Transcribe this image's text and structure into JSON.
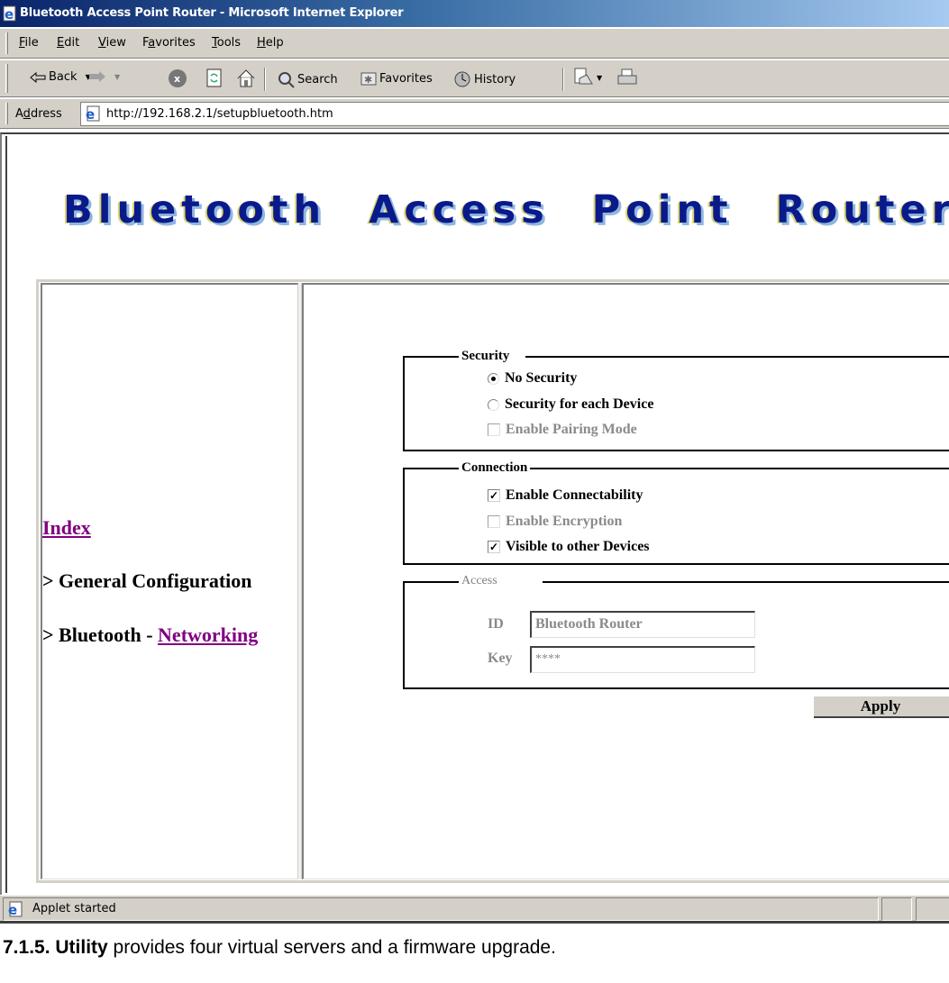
{
  "window": {
    "title": "Bluetooth Access Point Router - Microsoft Internet Explorer"
  },
  "menu": [
    {
      "label": "File",
      "access": "F",
      "rest": "ile"
    },
    {
      "label": "Edit",
      "access": "E",
      "rest": "dit"
    },
    {
      "label": "View",
      "access": "V",
      "rest": "iew"
    },
    {
      "label": "Favorites",
      "pre": "F",
      "access": "a",
      "rest": "vorites"
    },
    {
      "label": "Tools",
      "access": "T",
      "rest": "ools"
    },
    {
      "label": "Help",
      "access": "H",
      "rest": "elp"
    }
  ],
  "toolbar": {
    "back_label": "Back",
    "search_label": "Search",
    "favorites_label": "Favorites",
    "history_label": "History",
    "icons": [
      "back-arrow-icon",
      "forward-arrow-icon",
      "stop-icon",
      "refresh-icon",
      "home-icon",
      "search-icon",
      "favorites-icon",
      "history-icon",
      "mail-icon",
      "print-icon"
    ]
  },
  "address": {
    "label_pre": "A",
    "label_access": "d",
    "label_rest": "dress",
    "url": "http://192.168.2.1/setupbluetooth.htm"
  },
  "page": {
    "banner": "Bluetooth Access Point Router",
    "nav": {
      "index_link": "Index",
      "general_config": "> General Configuration",
      "bluetooth_prefix": "> Bluetooth - ",
      "networking_link": "Networking"
    },
    "security": {
      "legend": "Security",
      "options": [
        {
          "label": "No Security",
          "type": "radio",
          "checked": true,
          "disabled": false
        },
        {
          "label": "Security for each Device",
          "type": "radio",
          "checked": false,
          "disabled": false
        },
        {
          "label": "Enable Pairing Mode",
          "type": "checkbox",
          "checked": false,
          "disabled": true
        }
      ]
    },
    "connection": {
      "legend": "Connection",
      "options": [
        {
          "label": "Enable Connectability",
          "checked": true,
          "disabled": false
        },
        {
          "label": "Enable Encryption",
          "checked": false,
          "disabled": true
        },
        {
          "label": "Visible to other Devices",
          "checked": true,
          "disabled": false
        }
      ]
    },
    "access": {
      "legend": "Access",
      "id_label": "ID",
      "id_value": "Bluetooth Router",
      "key_label": "Key",
      "key_value": "****"
    },
    "apply_label": "Apply"
  },
  "status": {
    "text": "Applet started"
  },
  "caption": {
    "bold": "7.1.5. Utility",
    "rest": " provides four virtual servers and a firmware upgrade."
  }
}
